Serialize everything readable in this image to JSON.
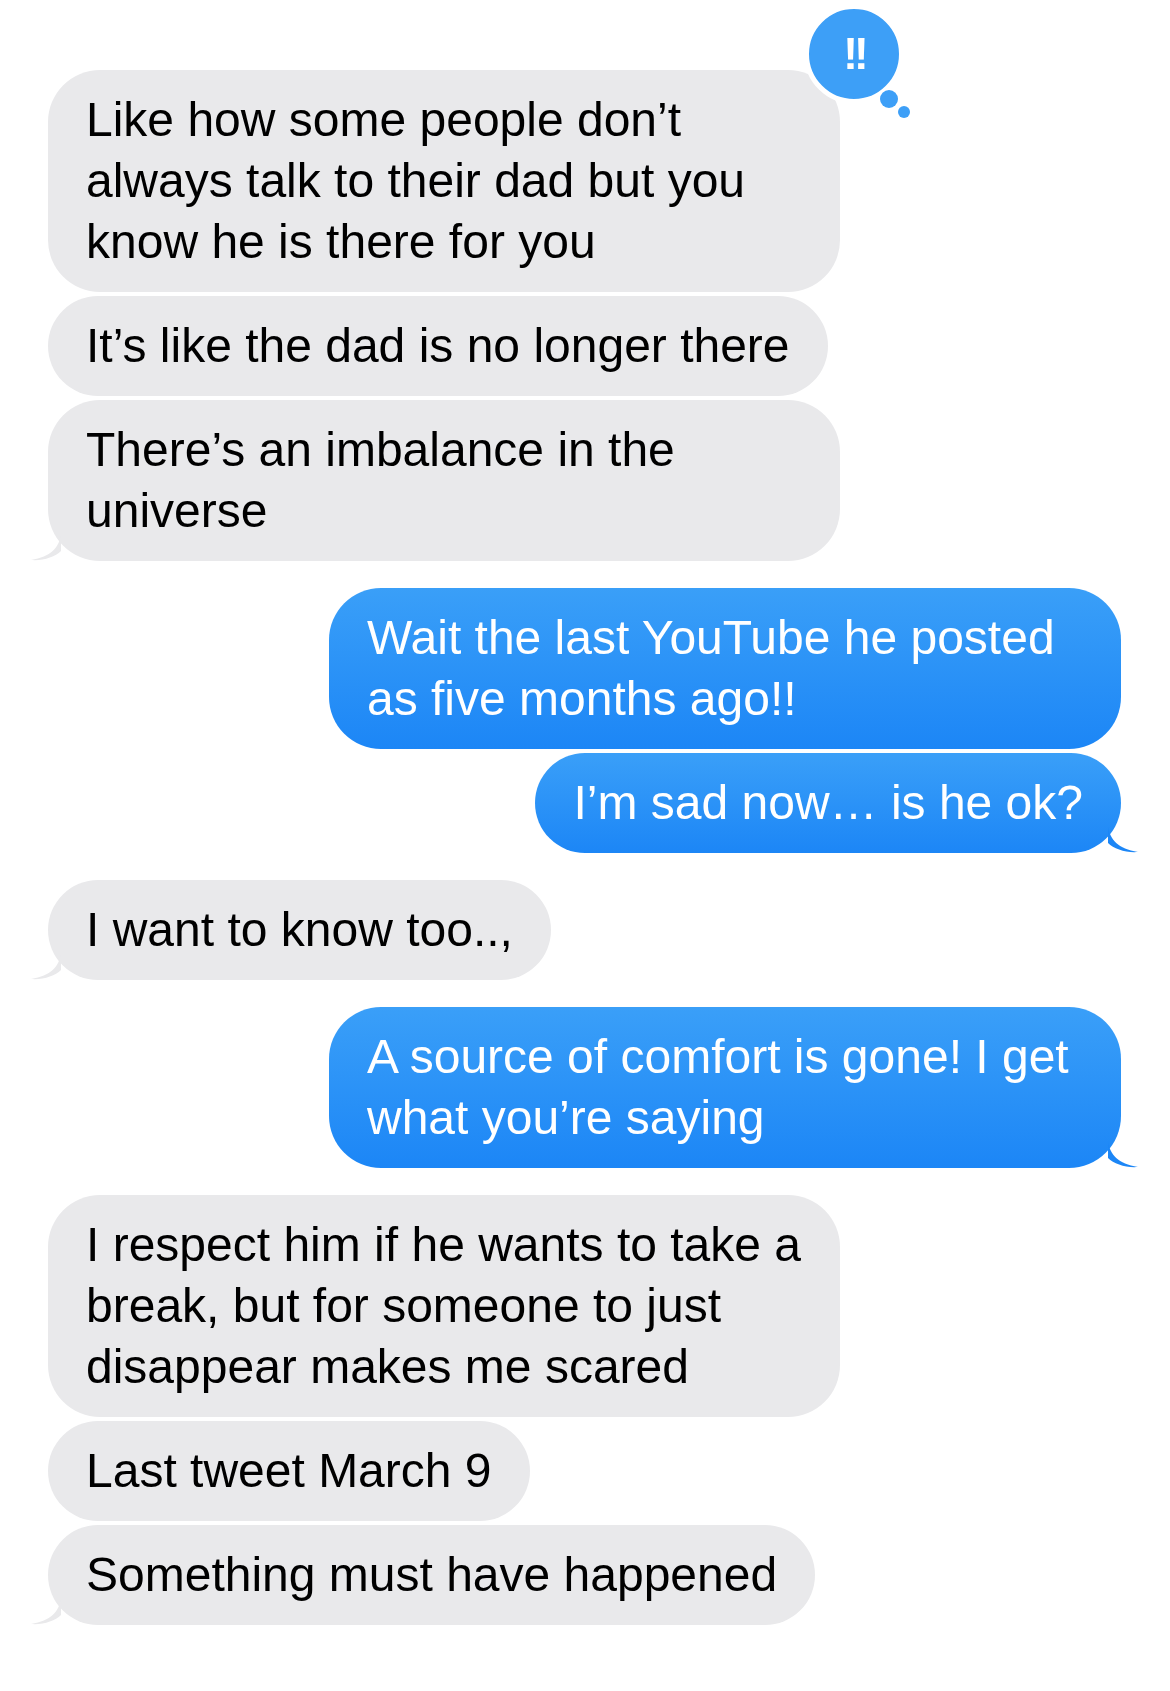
{
  "messages": [
    {
      "kind": "incoming",
      "text": "Like how some people don’t always talk to their dad but you know he is there for you",
      "tail": false,
      "tapback": "!!"
    },
    {
      "kind": "incoming",
      "text": "It’s like the dad is no longer there",
      "tail": false
    },
    {
      "kind": "incoming",
      "text": "There’s an imbalance in the universe",
      "tail": true
    },
    {
      "kind": "outgoing",
      "text": "Wait the last YouTube he posted as five months ago!!",
      "tail": false
    },
    {
      "kind": "outgoing",
      "text": "I’m sad now… is he ok?",
      "tail": true
    },
    {
      "kind": "incoming",
      "text": "I want to know too..,",
      "tail": true
    },
    {
      "kind": "outgoing",
      "text": "A source of comfort is gone! I get what you’re saying",
      "tail": true
    },
    {
      "kind": "incoming",
      "text": "I respect him if he wants to take a break, but for someone to just disappear makes me scared",
      "tail": false
    },
    {
      "kind": "incoming",
      "text": "Last tweet March 9",
      "tail": false
    },
    {
      "kind": "incoming",
      "text": "Something must have happened",
      "tail": true
    }
  ]
}
